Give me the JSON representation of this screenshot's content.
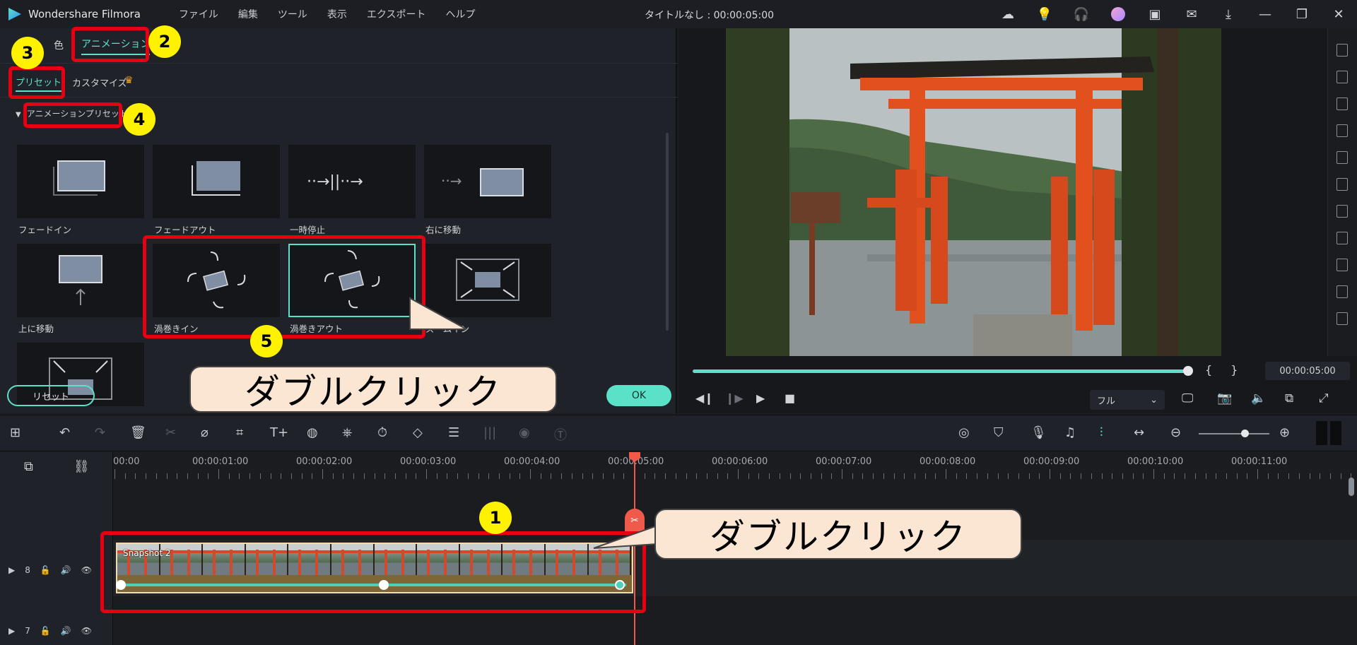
{
  "app": {
    "name": "Wondershare Filmora",
    "doc_title": "タイトルなし : 00:00:05:00"
  },
  "menu": [
    "ファイル",
    "編集",
    "ツール",
    "表示",
    "エクスポート",
    "ヘルプ"
  ],
  "titlebar_icons": [
    "cloud-icon",
    "bulb-icon",
    "headset-icon",
    "avatar-icon",
    "save-icon",
    "mail-icon",
    "download-icon",
    "minimize-icon",
    "restore-icon",
    "close-icon"
  ],
  "panel": {
    "tab_color": "色",
    "tab_animation": "アニメーション",
    "sub_preset": "プリセット",
    "sub_custom": "カスタマイズ",
    "section": "アニメーションプリセット",
    "presets": [
      "フェードイン",
      "フェードアウト",
      "一時停止",
      "右に移動",
      "上に移動",
      "渦巻きイン",
      "渦巻きアウト",
      "ズームイン",
      ""
    ],
    "reset_label": "リセット",
    "ok_label": "OK"
  },
  "preview": {
    "timecode": "00:00:05:00",
    "quality": "フル",
    "bracket_in": "{",
    "bracket_out": "}",
    "progress": 1.0
  },
  "timeline": {
    "ruler": [
      "00:00",
      "00:00:01:00",
      "00:00:02:00",
      "00:00:03:00",
      "00:00:04:00",
      "00:00:05:00",
      "00:00:06:00",
      "00:00:07:00",
      "00:00:08:00",
      "00:00:09:00",
      "00:00:10:00",
      "00:00:11:00"
    ],
    "track8_label": "8",
    "track7_label": "7",
    "clip_name": "Snapshot 2"
  },
  "annotations": {
    "badges": [
      "1",
      "2",
      "3",
      "4",
      "5"
    ],
    "callout_top": "ダブルクリック",
    "callout_bottom": "ダブルクリック"
  },
  "colors": {
    "accent": "#5ce1c9",
    "annotation_red": "#e60012",
    "badge_yellow": "#fff200",
    "playhead": "#ef5a4a"
  }
}
